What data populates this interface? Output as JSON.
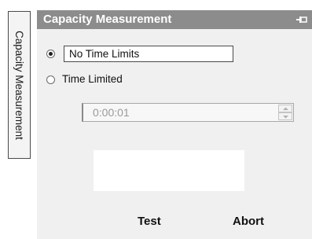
{
  "side_tab": {
    "label": "Capacity Measurement"
  },
  "panel": {
    "title": "Capacity Measurement"
  },
  "options": {
    "no_time_limits": {
      "label": "No Time Limits",
      "selected": true
    },
    "time_limited": {
      "label": "Time Limited",
      "selected": false
    }
  },
  "time_limit": {
    "value": "0:00:01"
  },
  "buttons": {
    "test": "Test",
    "abort": "Abort"
  },
  "icons": {
    "pin": "pin-icon",
    "spinner_up": "chevron-up-icon",
    "spinner_down": "chevron-down-icon"
  },
  "colors": {
    "titlebar": "#8c8c8c",
    "panel_bg": "#f0f0f0",
    "disabled_text": "#9a9a9a"
  }
}
